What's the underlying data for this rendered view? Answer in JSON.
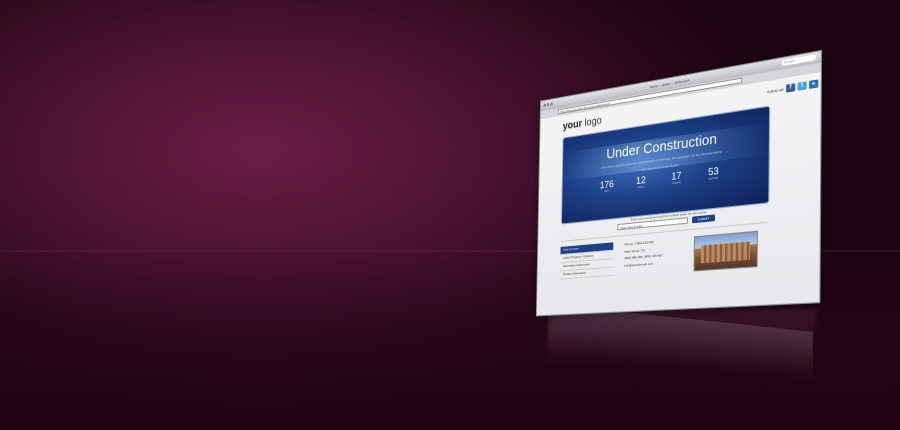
{
  "browser": {
    "chrome_title": "Name — Editor — Watermark",
    "search_placeholder": "Google",
    "address": "http://www.yourdomain.com/maintenance"
  },
  "site": {
    "logo_your": "your",
    "logo_logo": "logo",
    "follow_label": "follow us!",
    "social": [
      "f",
      "t",
      "in"
    ]
  },
  "hero": {
    "title": "Under Construction",
    "message": "Our site is currently down for maintenance or redesign. We apologize for any inconvenience.",
    "estimate": "Estimated time to site launch",
    "countdown": [
      {
        "value": "176",
        "unit": "days"
      },
      {
        "value": "12",
        "unit": "hours"
      },
      {
        "value": "17",
        "unit": "minutes"
      },
      {
        "value": "53",
        "unit": "seconds"
      }
    ]
  },
  "subscribe": {
    "notify_text": "Enter your email and we'll be notified when we are online",
    "email_placeholder": "Type Your E-mail",
    "submit_label": "SUBMIT"
  },
  "menu": {
    "items": [
      "Find Us Here",
      "Latest Projects / Updates",
      "Secondary Information",
      "Tertiary Information"
    ]
  },
  "contact": {
    "phone": "Phone: 1-800-123-456",
    "address": "Main Street, CA",
    "fax": "(800) 456-456, (800) 456-457",
    "email": "info@yourdomain.com"
  },
  "colors": {
    "background": "#4a1230",
    "accent": "#1d3f86",
    "facebook": "#3b5998",
    "twitter": "#4aa3df",
    "linkedin": "#2a6fb0"
  }
}
